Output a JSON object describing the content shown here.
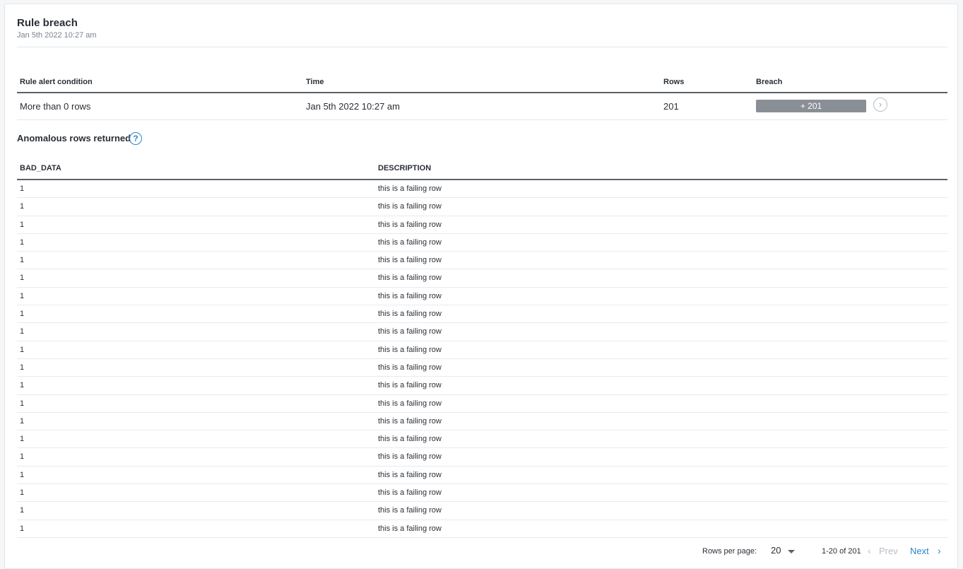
{
  "header": {
    "title": "Rule breach",
    "subtitle": "Jan 5th 2022 10:27 am"
  },
  "summary": {
    "columns": [
      "Rule alert condition",
      "Time",
      "Rows",
      "Breach"
    ],
    "row": {
      "condition": "More than 0 rows",
      "time": "Jan 5th 2022 10:27 am",
      "rows": "201",
      "breach": "+ 201"
    }
  },
  "anomalous": {
    "title": "Anomalous rows returned",
    "help_icon": "question-circle-icon",
    "columns": [
      "BAD_DATA",
      "DESCRIPTION"
    ],
    "rows": [
      [
        "1",
        "this is a failing row"
      ],
      [
        "1",
        "this is a failing row"
      ],
      [
        "1",
        "this is a failing row"
      ],
      [
        "1",
        "this is a failing row"
      ],
      [
        "1",
        "this is a failing row"
      ],
      [
        "1",
        "this is a failing row"
      ],
      [
        "1",
        "this is a failing row"
      ],
      [
        "1",
        "this is a failing row"
      ],
      [
        "1",
        "this is a failing row"
      ],
      [
        "1",
        "this is a failing row"
      ],
      [
        "1",
        "this is a failing row"
      ],
      [
        "1",
        "this is a failing row"
      ],
      [
        "1",
        "this is a failing row"
      ],
      [
        "1",
        "this is a failing row"
      ],
      [
        "1",
        "this is a failing row"
      ],
      [
        "1",
        "this is a failing row"
      ],
      [
        "1",
        "this is a failing row"
      ],
      [
        "1",
        "this is a failing row"
      ],
      [
        "1",
        "this is a failing row"
      ],
      [
        "1",
        "this is a failing row"
      ]
    ]
  },
  "pagination": {
    "rows_per_page_label": "Rows per page:",
    "rows_per_page": "20",
    "range": "1-20 of 201",
    "prev_label": "Prev",
    "next_label": "Next"
  },
  "colors": {
    "accent": "#2a86c8",
    "breach_bar": "#8a8f96"
  }
}
